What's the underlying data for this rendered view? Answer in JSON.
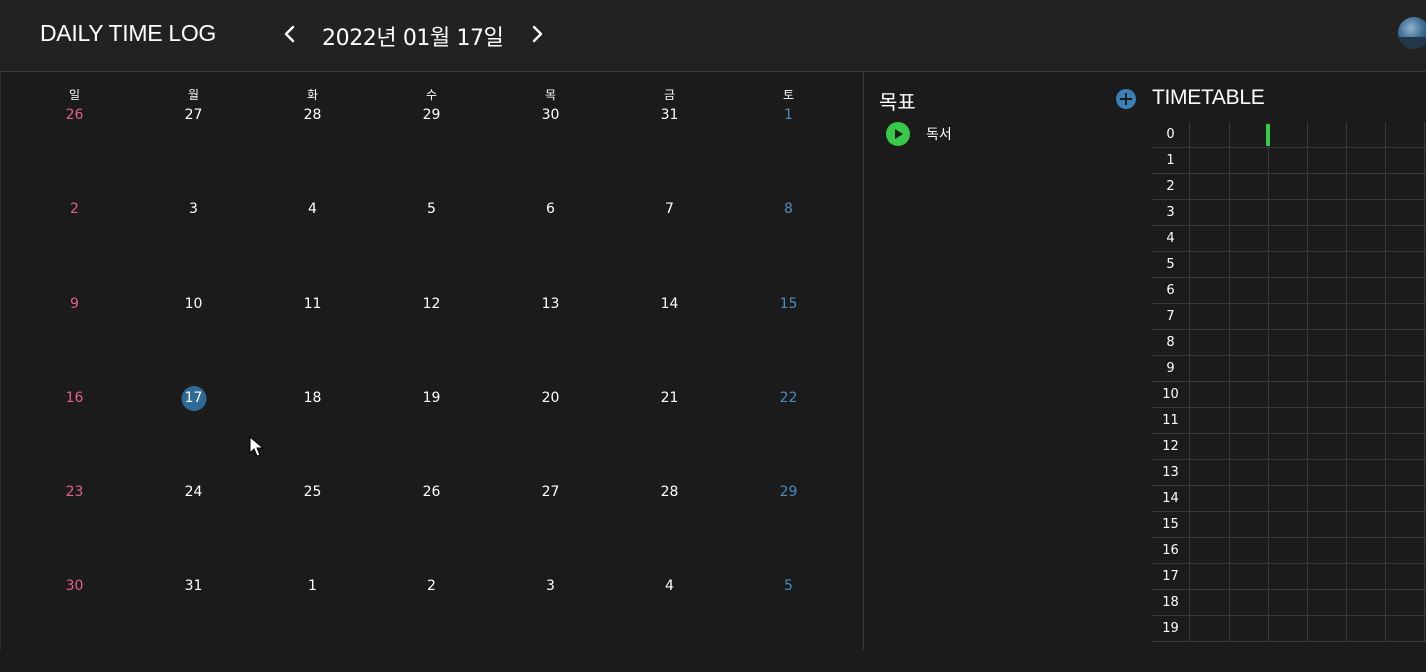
{
  "header": {
    "title": "DAILY TIME LOG",
    "date": "2022년 01월 17일",
    "prev_icon": "chevron-left-icon",
    "next_icon": "chevron-right-icon"
  },
  "calendar": {
    "weekdays": [
      "일",
      "월",
      "화",
      "수",
      "목",
      "금",
      "토"
    ],
    "weeks": [
      [
        "26",
        "27",
        "28",
        "29",
        "30",
        "31",
        "1"
      ],
      [
        "2",
        "3",
        "4",
        "5",
        "6",
        "7",
        "8"
      ],
      [
        "9",
        "10",
        "11",
        "12",
        "13",
        "14",
        "15"
      ],
      [
        "16",
        "17",
        "18",
        "19",
        "20",
        "21",
        "22"
      ],
      [
        "23",
        "24",
        "25",
        "26",
        "27",
        "28",
        "29"
      ],
      [
        "30",
        "31",
        "1",
        "2",
        "3",
        "4",
        "5"
      ]
    ],
    "selected_day": "17",
    "colors": {
      "sunday": "#e0628a",
      "saturday": "#4b8cc0",
      "selected": "#2f6a96"
    }
  },
  "goals": {
    "title": "목표",
    "add_icon": "plus-circle-icon",
    "items": [
      {
        "label": "독서",
        "icon": "play-icon",
        "color": "#38c84a"
      }
    ]
  },
  "timetable": {
    "title": "TIMETABLE",
    "hours": [
      "0",
      "1",
      "2",
      "3",
      "4",
      "5",
      "6",
      "7",
      "8",
      "9",
      "10",
      "11",
      "12",
      "13",
      "14",
      "15",
      "16",
      "17",
      "18",
      "19"
    ]
  }
}
